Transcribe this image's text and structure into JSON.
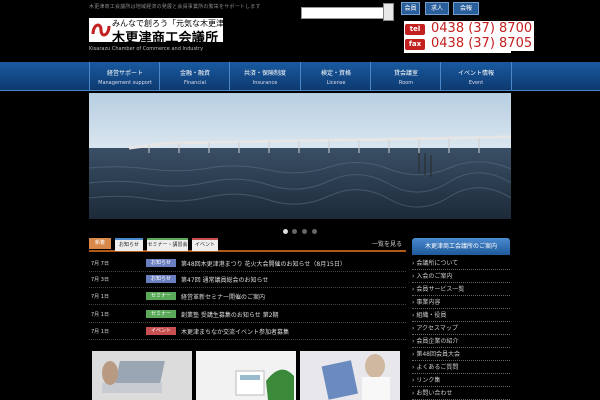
{
  "header": {
    "top_text": "木更津商工会議所は地域経済の発展と会員事業所の繁栄をサポートします",
    "logo_tagline": "みんなで創ろう「元気な木更津」",
    "logo_name": "木更津商工会議所",
    "logo_english": "Kisarazu Chamber of Commerce and Industry",
    "search_placeholder": "",
    "util_links": [
      "会員",
      "求人",
      "会報"
    ],
    "tel_label": "tel",
    "tel_number": "0438 (37) 8700",
    "fax_label": "fax",
    "fax_number": "0438 (37) 8705"
  },
  "nav": [
    {
      "jp": "経営サポート",
      "en": "Management support"
    },
    {
      "jp": "金融・融資",
      "en": "Financial"
    },
    {
      "jp": "共済・保険制度",
      "en": "Insurance"
    },
    {
      "jp": "検定・資格",
      "en": "License"
    },
    {
      "jp": "貸会議室",
      "en": "Room"
    },
    {
      "jp": "イベント情報",
      "en": "Event"
    }
  ],
  "tabs": [
    "新着",
    "お知らせ",
    "セミナー・講習会",
    "イベント"
  ],
  "tab_more": "一覧を見る",
  "news": [
    {
      "date": "7月 7日",
      "cat": "お知らせ",
      "cat_color": "#6a7fc0",
      "title": "第48回木更津港まつり 花火大会開催のお知らせ（8月15日）"
    },
    {
      "date": "7月 3日",
      "cat": "お知らせ",
      "cat_color": "#6a7fc0",
      "title": "第47回 通常議員総会のお知らせ"
    },
    {
      "date": "7月 1日",
      "cat": "セミナー",
      "cat_color": "#5aaa5a",
      "title": "経営革新セミナー開催のご案内"
    },
    {
      "date": "7月 1日",
      "cat": "セミナー",
      "cat_color": "#5aaa5a",
      "title": "創業塾 受講生募集のお知らせ 第2期"
    },
    {
      "date": "7月 1日",
      "cat": "イベント",
      "cat_color": "#c85050",
      "title": "木更津まちなか交流イベント参加者募集"
    }
  ],
  "sidebar": {
    "heading": "木更津商工会議所のご案内",
    "links": [
      "会議所について",
      "入会のご案内",
      "会員サービス一覧",
      "事業内容",
      "組織・役員",
      "アクセスマップ",
      "会員企業の紹介",
      "第48回会員大会",
      "よくあるご質問",
      "リンク集",
      "お問い合わせ"
    ]
  }
}
